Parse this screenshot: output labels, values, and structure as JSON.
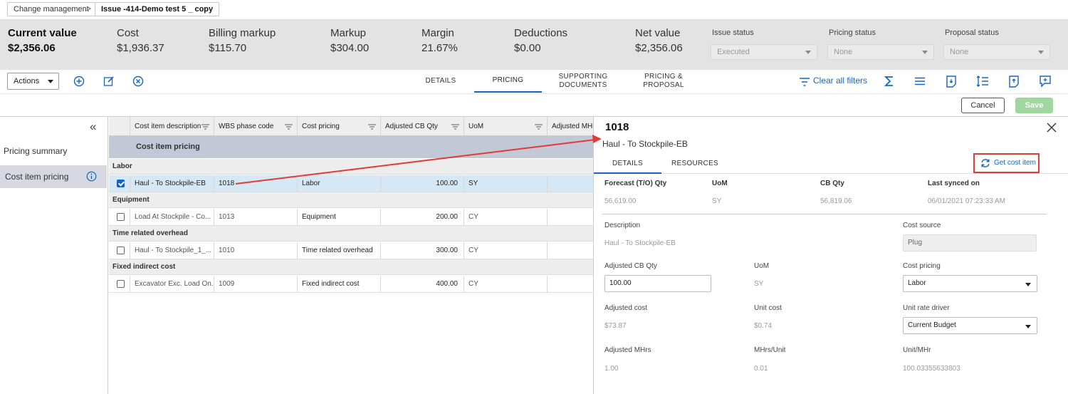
{
  "breadcrumb": {
    "items": [
      "Change management",
      "Issue -414-Demo test 5 _ copy"
    ],
    "separator": ">"
  },
  "summary": {
    "metrics": [
      {
        "label": "Current value",
        "value": "$2,356.06"
      },
      {
        "label": "Cost",
        "value": "$1,936.37"
      },
      {
        "label": "Billing markup",
        "value": "$115.70"
      },
      {
        "label": "Markup",
        "value": "$304.00"
      },
      {
        "label": "Margin",
        "value": "21.67%"
      },
      {
        "label": "Deductions",
        "value": "$0.00"
      },
      {
        "label": "Net value",
        "value": "$2,356.06"
      }
    ],
    "statuses": [
      {
        "label": "Issue status",
        "value": "Executed"
      },
      {
        "label": "Pricing status",
        "value": "None"
      },
      {
        "label": "Proposal status",
        "value": "None"
      }
    ]
  },
  "toolbar": {
    "actions_label": "Actions",
    "tabs": [
      {
        "label": "DETAILS"
      },
      {
        "label": "PRICING"
      },
      {
        "label": "SUPPORTING DOCUMENTS"
      },
      {
        "label": "PRICING & PROPOSAL"
      }
    ],
    "clear_filters": "Clear all filters"
  },
  "buttons": {
    "cancel": "Cancel",
    "save": "Save"
  },
  "sidebar": {
    "collapse_glyph": "«",
    "items": [
      {
        "label": "Pricing summary"
      },
      {
        "label": "Cost item pricing"
      }
    ]
  },
  "grid": {
    "columns": [
      "Cost item description",
      "WBS phase code",
      "Cost pricing",
      "Adjusted CB Qty",
      "UoM",
      "Adjusted MHrs"
    ],
    "band": "Cost item pricing",
    "groups": [
      {
        "name": "Labor",
        "rows": [
          {
            "checked": true,
            "desc": "Haul  - To Stockpile-EB",
            "wbs": "1018",
            "pricing": "Labor",
            "qty": "100.00",
            "uom": "SY"
          }
        ]
      },
      {
        "name": "Equipment",
        "rows": [
          {
            "checked": false,
            "desc": "Load At Stockpile - Co...",
            "wbs": "1013",
            "pricing": "Equipment",
            "qty": "200.00",
            "uom": "CY"
          }
        ]
      },
      {
        "name": "Time related overhead",
        "rows": [
          {
            "checked": false,
            "desc": "Haul  - To Stockpile_1_...",
            "wbs": "1010",
            "pricing": "Time related overhead",
            "qty": "300.00",
            "uom": "CY"
          }
        ]
      },
      {
        "name": "Fixed indirect cost",
        "rows": [
          {
            "checked": false,
            "desc": "Excavator Exc. Load On...",
            "wbs": "1009",
            "pricing": "Fixed indirect cost",
            "qty": "400.00",
            "uom": "CY"
          }
        ]
      }
    ]
  },
  "panel": {
    "title": "1018",
    "subtitle": "Haul - To Stockpile-EB",
    "tabs": [
      "DETAILS",
      "RESOURCES"
    ],
    "get_cost_item": "Get cost item",
    "summary_fields": [
      {
        "label": "Forecast (T/O) Qty",
        "value": "56,619.00"
      },
      {
        "label": "UoM",
        "value": "SY"
      },
      {
        "label": "CB Qty",
        "value": "56,819.06"
      },
      {
        "label": "Last synced on",
        "value": "06/01/2021 07:23:33 AM"
      }
    ],
    "description_label": "Description",
    "description_value": "Haul - To Stockpile-EB",
    "cost_source_label": "Cost source",
    "cost_source_value": "Plug",
    "adjusted_cb_qty_label": "Adjusted CB Qty",
    "adjusted_cb_qty_value": "100.00",
    "uom_label": "UoM",
    "uom_value": "SY",
    "cost_pricing_label": "Cost pricing",
    "cost_pricing_value": "Labor",
    "adjusted_cost_label": "Adjusted cost",
    "adjusted_cost_value": "$73.87",
    "unit_cost_label": "Unit cost",
    "unit_cost_value": "$0.74",
    "unit_rate_driver_label": "Unit rate driver",
    "unit_rate_driver_value": "Current Budget",
    "adjusted_mhrs_label": "Adjusted MHrs",
    "adjusted_mhrs_value": "1.00",
    "mhrs_unit_label": "MHrs/Unit",
    "mhrs_unit_value": "0.01",
    "unit_mhr_label": "Unit/MHr",
    "unit_mhr_value": "100.03355633803"
  },
  "colors": {
    "accent": "#1565c0",
    "highlight": "#e53935",
    "summary_bg": "#e3e3e3",
    "selected_row": "#d5e8f3"
  }
}
